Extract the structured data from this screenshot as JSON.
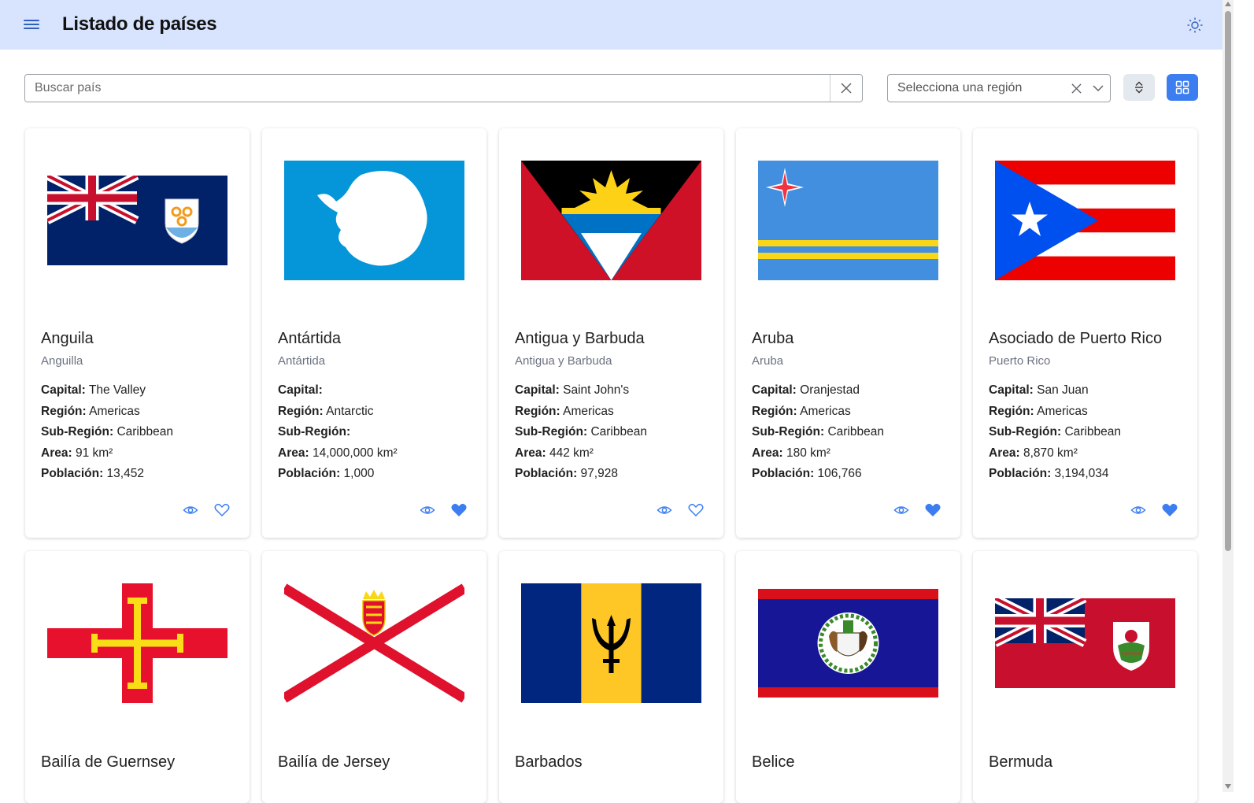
{
  "header": {
    "title": "Listado de países"
  },
  "search": {
    "placeholder": "Buscar país"
  },
  "region_filter": {
    "placeholder": "Selecciona una región"
  },
  "labels": {
    "capital": "Capital:",
    "region": "Región:",
    "subregion": "Sub-Región:",
    "area": "Area:",
    "population": "Población:"
  },
  "colors": {
    "accent": "#3c7ef0",
    "header_bg": "#d8e3fd",
    "favorite": "#3c7ef0"
  },
  "countries": [
    {
      "name": "Anguila",
      "native": "Anguilla",
      "capital": "The Valley",
      "region": "Americas",
      "subregion": "Caribbean",
      "area": "91 km²",
      "population": "13,452",
      "favorite": false,
      "flag": "anguilla-flag"
    },
    {
      "name": "Antártida",
      "native": "Antártida",
      "capital": "",
      "region": "Antarctic",
      "subregion": "",
      "area": "14,000,000 km²",
      "population": "1,000",
      "favorite": true,
      "flag": "antarctica-flag"
    },
    {
      "name": "Antigua y Barbuda",
      "native": "Antigua y Barbuda",
      "capital": "Saint John's",
      "region": "Americas",
      "subregion": "Caribbean",
      "area": "442 km²",
      "population": "97,928",
      "favorite": false,
      "flag": "antigua-flag"
    },
    {
      "name": "Aruba",
      "native": "Aruba",
      "capital": "Oranjestad",
      "region": "Americas",
      "subregion": "Caribbean",
      "area": "180 km²",
      "population": "106,766",
      "favorite": true,
      "flag": "aruba-flag"
    },
    {
      "name": "Asociado de Puerto Rico",
      "native": "Puerto Rico",
      "capital": "San Juan",
      "region": "Americas",
      "subregion": "Caribbean",
      "area": "8,870 km²",
      "population": "3,194,034",
      "favorite": true,
      "flag": "puerto-rico-flag"
    },
    {
      "name": "Bailía de Guernsey",
      "flag": "guernsey-flag"
    },
    {
      "name": "Bailía de Jersey",
      "flag": "jersey-flag"
    },
    {
      "name": "Barbados",
      "flag": "barbados-flag"
    },
    {
      "name": "Belice",
      "flag": "belize-flag"
    },
    {
      "name": "Bermuda",
      "flag": "bermuda-flag"
    }
  ]
}
